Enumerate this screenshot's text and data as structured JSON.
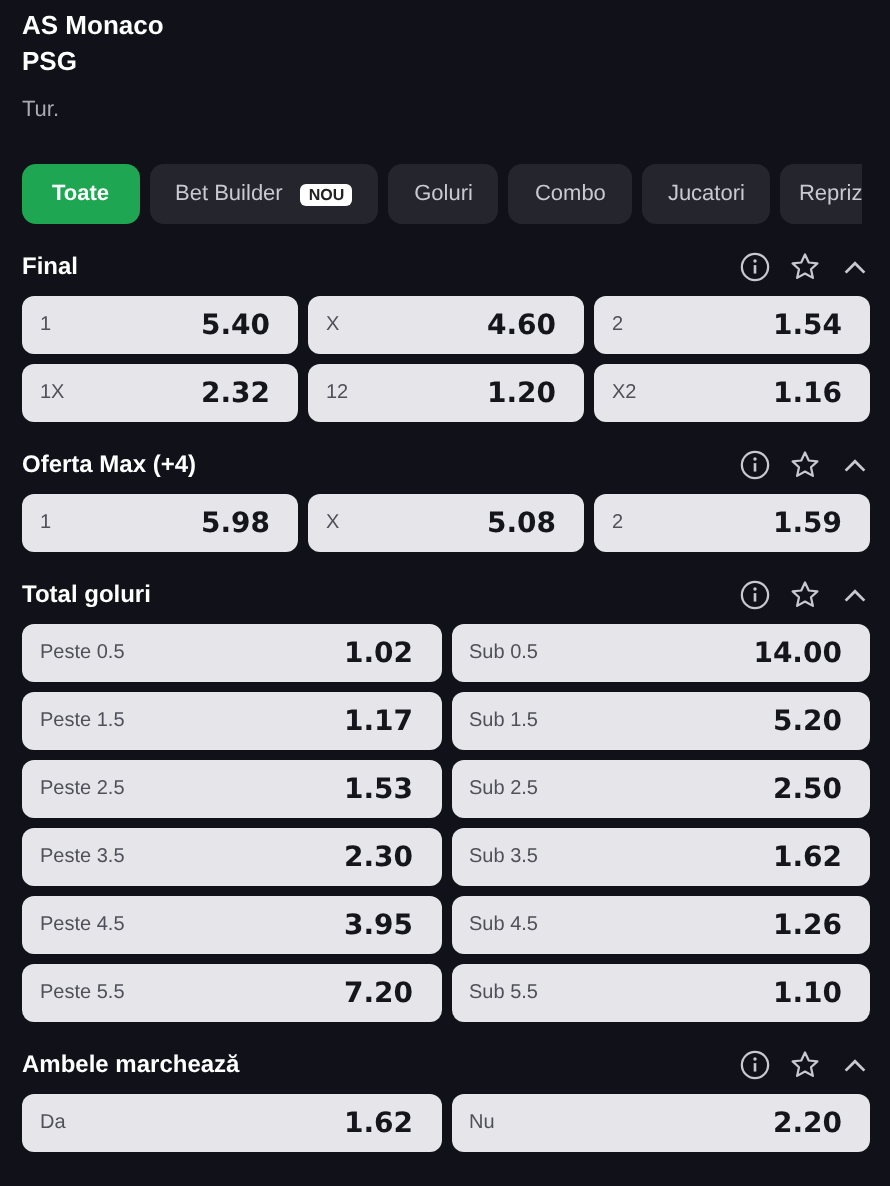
{
  "header": {
    "home": "AS Monaco",
    "away": "PSG",
    "subtitle": "Tur."
  },
  "tabs": [
    {
      "label": "Toate",
      "selected": true
    },
    {
      "label": "Bet Builder",
      "selected": false,
      "badge": "NOU"
    },
    {
      "label": "Goluri",
      "selected": false
    },
    {
      "label": "Combo",
      "selected": false
    },
    {
      "label": "Jucatori",
      "selected": false
    },
    {
      "label": "Repriz",
      "selected": false
    }
  ],
  "markets": [
    {
      "title": "Final",
      "kind": "three-way",
      "odds": [
        {
          "label": "1",
          "value": "5.40"
        },
        {
          "label": "X",
          "value": "4.60"
        },
        {
          "label": "2",
          "value": "1.54"
        },
        {
          "label": "1X",
          "value": "2.32"
        },
        {
          "label": "12",
          "value": "1.20"
        },
        {
          "label": "X2",
          "value": "1.16"
        }
      ]
    },
    {
      "title": "Oferta Max (+4)",
      "kind": "three-way",
      "odds": [
        {
          "label": "1",
          "value": "5.98"
        },
        {
          "label": "X",
          "value": "5.08"
        },
        {
          "label": "2",
          "value": "1.59"
        }
      ]
    },
    {
      "title": "Total goluri",
      "kind": "two-way",
      "odds": [
        {
          "label": "Peste 0.5",
          "value": "1.02"
        },
        {
          "label": "Sub 0.5",
          "value": "14.00"
        },
        {
          "label": "Peste 1.5",
          "value": "1.17"
        },
        {
          "label": "Sub 1.5",
          "value": "5.20"
        },
        {
          "label": "Peste 2.5",
          "value": "1.53"
        },
        {
          "label": "Sub 2.5",
          "value": "2.50"
        },
        {
          "label": "Peste 3.5",
          "value": "2.30"
        },
        {
          "label": "Sub 3.5",
          "value": "1.62"
        },
        {
          "label": "Peste 4.5",
          "value": "3.95"
        },
        {
          "label": "Sub 4.5",
          "value": "1.26"
        },
        {
          "label": "Peste 5.5",
          "value": "7.20"
        },
        {
          "label": "Sub 5.5",
          "value": "1.10"
        }
      ]
    },
    {
      "title": "Ambele marchează",
      "kind": "two-way",
      "odds": [
        {
          "label": "Da",
          "value": "1.62"
        },
        {
          "label": "Nu",
          "value": "2.20"
        }
      ]
    }
  ]
}
